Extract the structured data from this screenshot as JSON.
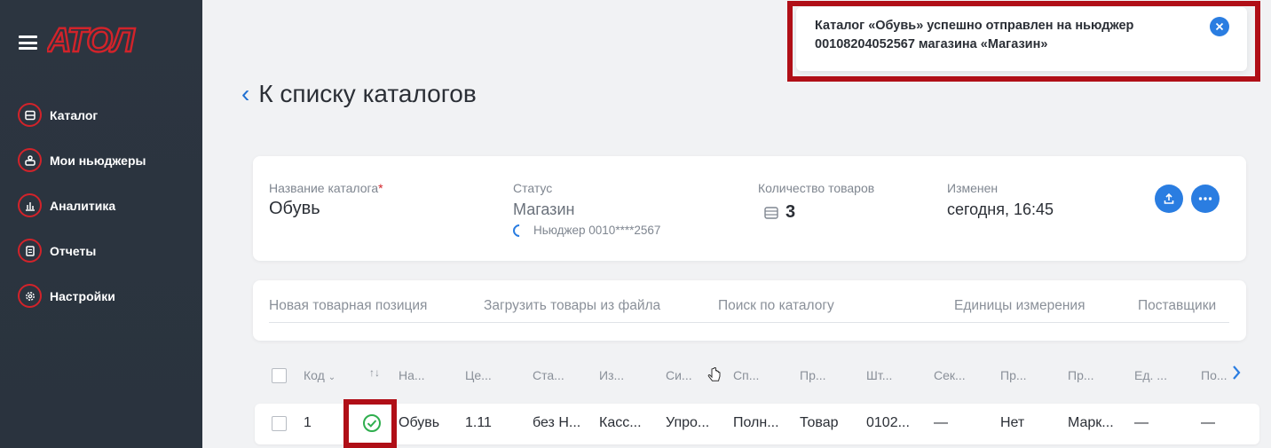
{
  "sidebar": {
    "logo_text": "АТОЛ",
    "items": [
      {
        "label": "Каталог",
        "icon": "catalog-icon"
      },
      {
        "label": "Мои ньюджеры",
        "icon": "devices-icon"
      },
      {
        "label": "Аналитика",
        "icon": "analytics-icon"
      },
      {
        "label": "Отчеты",
        "icon": "reports-icon"
      },
      {
        "label": "Настройки",
        "icon": "settings-icon"
      }
    ]
  },
  "page": {
    "back_label": "К списку каталогов"
  },
  "toast": {
    "message": "Каталог «Обувь» успешно отправлен на ньюджер 00108204052567 магазина «Магазин»"
  },
  "card": {
    "name_label": "Название каталога",
    "name_required": "*",
    "name_value": "Обувь",
    "status_label": "Статус",
    "status_value": "Магазин",
    "status_sub": "Ньюджер 0010****2567",
    "count_label": "Количество товаров",
    "count_value": "3",
    "modified_label": "Изменен",
    "modified_value": "сегодня, 16:45"
  },
  "actions": [
    "Новая товарная позиция",
    "Загрузить товары из файла",
    "Поиск по каталогу",
    "Единицы измерения",
    "Поставщики"
  ],
  "table": {
    "columns": [
      "Код",
      "↑↓",
      "На...",
      "Це...",
      "Ста...",
      "Из...",
      "Си...",
      "Сп...",
      "Пр...",
      "Шт...",
      "Сек...",
      "Пр...",
      "Пр...",
      "Ед. ...",
      "По..."
    ],
    "rows": [
      [
        "1",
        "Обувь",
        "1.11",
        "без Н...",
        "Касс...",
        "Упро...",
        "Полн...",
        "Товар",
        "0102...",
        "—",
        "Нет",
        "Марк...",
        "—",
        "—"
      ]
    ]
  },
  "colors": {
    "sidebar_bg": "#2c3540",
    "accent_blue": "#2a7de1",
    "brand_red": "#d2232a",
    "success_green": "#2fae4e"
  }
}
